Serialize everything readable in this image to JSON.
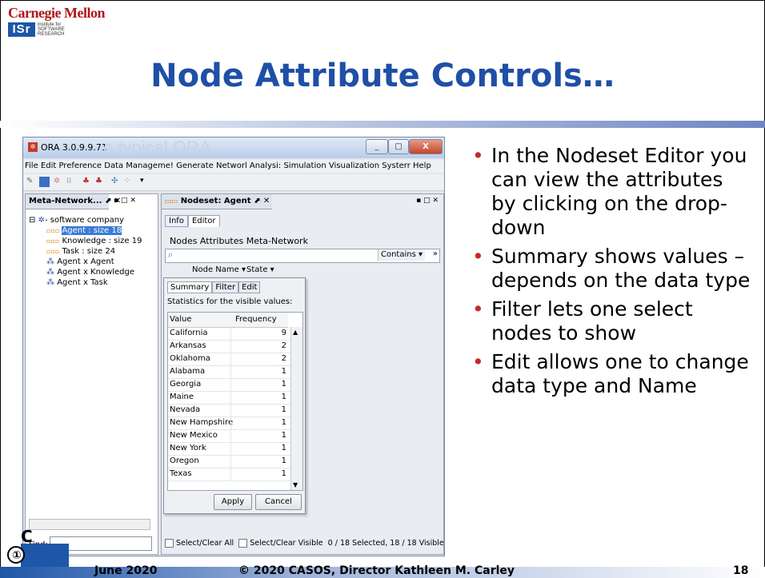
{
  "header": {
    "university": "Carnegie Mellon",
    "isr_abbrev": "ISr",
    "isr_text": [
      "institute for",
      "SOFTWARE",
      "RESEARCH"
    ]
  },
  "slide": {
    "title": "Node Attribute Controls…"
  },
  "app": {
    "window_title": "ORA 3.0.9.9.71",
    "ghost_text": "e typical ORA",
    "window_buttons": [
      "_",
      "□",
      "X"
    ],
    "menu": "File Edit Preference Data Manageme! Generate Networl Analysi: Simulation Visualization Systerr Help",
    "left_panel": {
      "tab_label": "Meta-Network...",
      "tree": [
        {
          "label": "software company",
          "icon": "network-icon"
        },
        {
          "label": "Agent : size 18",
          "icon": "nodeset-icon",
          "selected": true
        },
        {
          "label": "Knowledge : size 19",
          "icon": "nodeset-icon"
        },
        {
          "label": "Task : size 24",
          "icon": "nodeset-icon"
        },
        {
          "label": "Agent x Agent",
          "icon": "network-icon"
        },
        {
          "label": "Agent x Knowledge",
          "icon": "network-icon"
        },
        {
          "label": "Agent x Task",
          "icon": "network-icon"
        }
      ],
      "find_label": "Find:"
    },
    "right_panel": {
      "tab_label": "Nodeset: Agent",
      "subtabs": [
        "Info",
        "Editor"
      ],
      "editor_nav": "Nodes  Attributes  Meta-Network",
      "search_mode": "Contains",
      "col_node_name": "Node Name",
      "col_state": "State",
      "status": {
        "select_all": "Select/Clear All",
        "select_visible": "Select/Clear Visible",
        "counts": "0 / 18 Selected, 18 / 18 Visible"
      }
    },
    "popup": {
      "tabs": [
        "Summary",
        "Filter",
        "Edit"
      ],
      "stats_label": "Statistics for the visible values:",
      "col_value": "Value",
      "col_frequency": "Frequency",
      "rows": [
        {
          "value": "California",
          "freq": "9"
        },
        {
          "value": "Arkansas",
          "freq": "2"
        },
        {
          "value": "Oklahoma",
          "freq": "2"
        },
        {
          "value": "Alabama",
          "freq": "1"
        },
        {
          "value": "Georgia",
          "freq": "1"
        },
        {
          "value": "Maine",
          "freq": "1"
        },
        {
          "value": "Nevada",
          "freq": "1"
        },
        {
          "value": "New Hampshire",
          "freq": "1"
        },
        {
          "value": "New Mexico",
          "freq": "1"
        },
        {
          "value": "New York",
          "freq": "1"
        },
        {
          "value": "Oregon",
          "freq": "1"
        },
        {
          "value": "Texas",
          "freq": "1"
        }
      ],
      "apply": "Apply",
      "cancel": "Cancel"
    }
  },
  "bullets": [
    "In the Nodeset Editor you can view the attributes by clicking on the drop-down",
    "Summary shows values – depends on the data type",
    "Filter lets one select nodes to show",
    "Edit allows one to change data type and Name"
  ],
  "footer": {
    "date": "June 2020",
    "copyright": "© 2020 CASOS, Director Kathleen M. Carley",
    "page": "18"
  },
  "colors": {
    "title_blue": "#1f4fa6",
    "cmu_red": "#b0161c",
    "bullet_red": "#c8282c"
  }
}
